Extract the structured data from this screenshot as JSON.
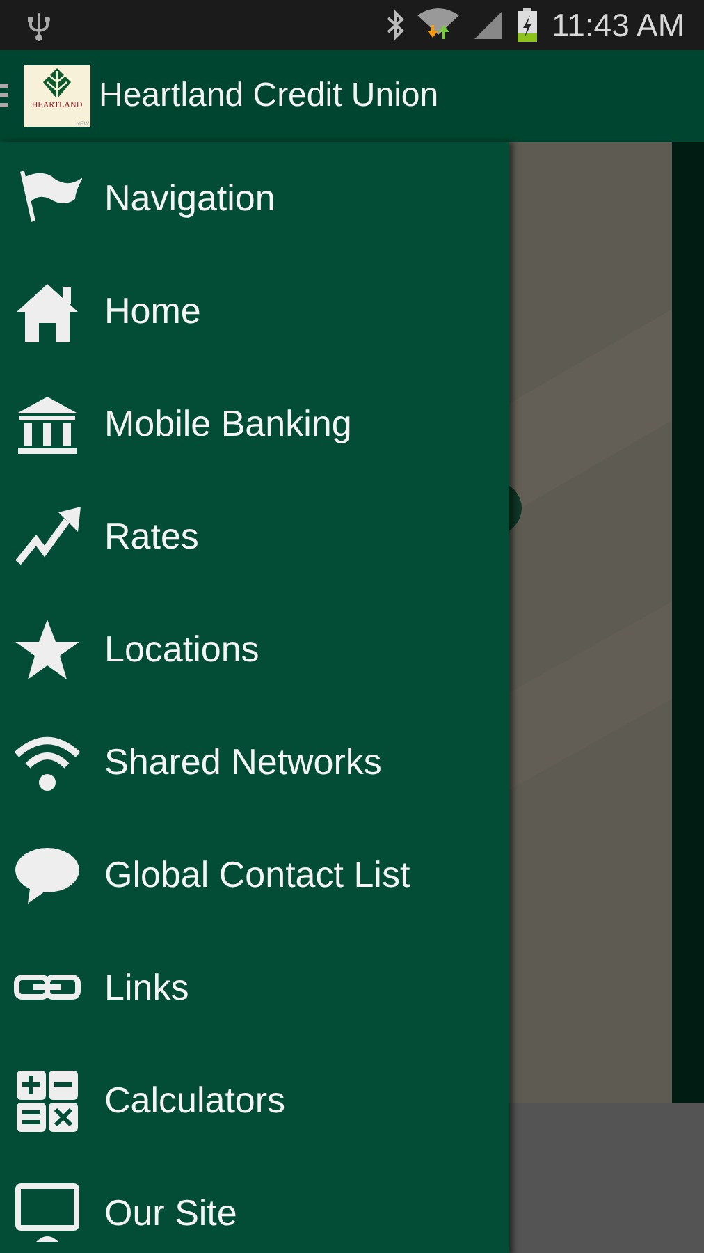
{
  "status_bar": {
    "time": "11:43 AM"
  },
  "app_bar": {
    "logo_text": "HEARTLAND",
    "logo_badge": "NEW",
    "title": "Heartland Credit Union"
  },
  "drawer": {
    "heading": "Navigation",
    "items": [
      {
        "label": "Home"
      },
      {
        "label": "Mobile Banking"
      },
      {
        "label": "Rates"
      },
      {
        "label": "Locations"
      },
      {
        "label": "Shared Networks"
      },
      {
        "label": "Global Contact List"
      },
      {
        "label": "Links"
      },
      {
        "label": "Calculators"
      },
      {
        "label": "Our Site"
      }
    ]
  }
}
